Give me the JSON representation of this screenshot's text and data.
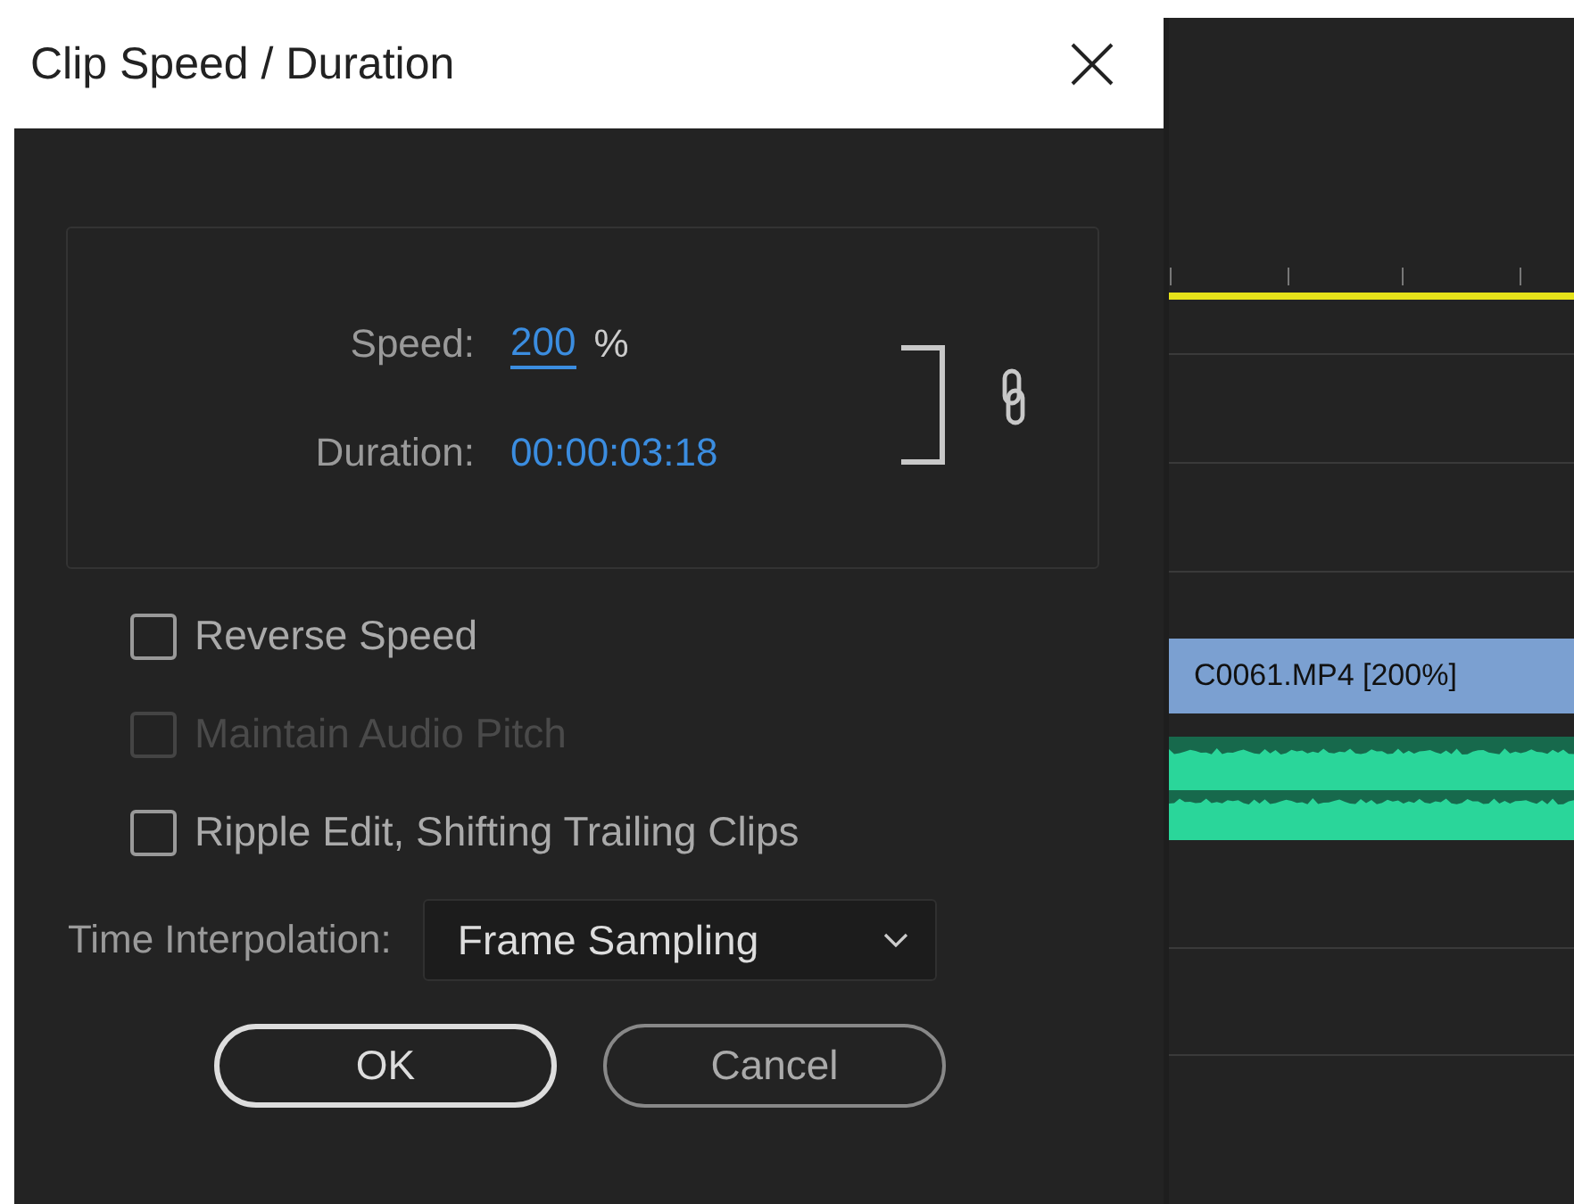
{
  "dialog": {
    "title": "Clip Speed / Duration"
  },
  "speed": {
    "label": "Speed:",
    "value": "200",
    "unit": "%"
  },
  "duration": {
    "label": "Duration:",
    "value": "00:00:03:18"
  },
  "options": [
    {
      "label": "Reverse Speed",
      "checked": false,
      "disabled": false
    },
    {
      "label": "Maintain Audio Pitch",
      "checked": false,
      "disabled": true
    },
    {
      "label": "Ripple Edit, Shifting Trailing Clips",
      "checked": false,
      "disabled": false
    }
  ],
  "interpolation": {
    "label": "Time Interpolation:",
    "value": "Frame Sampling"
  },
  "buttons": [
    {
      "label": "OK",
      "kind": "default"
    },
    {
      "label": "Cancel",
      "kind": "normal"
    }
  ],
  "timeline": {
    "clip": "C0061.MP4 [200%]"
  }
}
